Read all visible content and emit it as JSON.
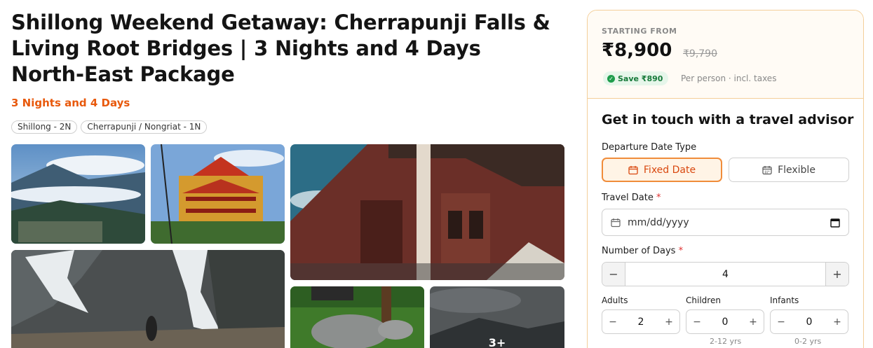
{
  "package": {
    "title": "Shillong Weekend Getaway: Cherrapunji Falls & Living Root Bridges | 3 Nights and 4 Days North-East Package",
    "duration": "3 Nights and 4 Days",
    "chips": [
      "Shillong - 2N",
      "Cherrapunji / Nongriat - 1N"
    ]
  },
  "gallery": {
    "more_label": "3+"
  },
  "pricing": {
    "starting_from": "STARTING FROM",
    "price": "₹8,900",
    "old_price": "₹9,790",
    "save_label": "Save ₹890",
    "per_person": "Per person · incl. taxes"
  },
  "form": {
    "title": "Get in touch with a travel advisor",
    "departure_label": "Departure Date Type",
    "fixed_label": "Fixed Date",
    "flexible_label": "Flexible",
    "travel_date_label": "Travel Date",
    "required_mark": "*",
    "date_placeholder": "mm/dd/yyyy",
    "days_label": "Number of Days",
    "days_value": "4",
    "minus": "−",
    "plus": "+",
    "adults_label": "Adults",
    "adults_value": "2",
    "children_label": "Children",
    "children_value": "0",
    "children_hint": "2-12 yrs",
    "infants_label": "Infants",
    "infants_value": "0",
    "infants_hint": "0-2 yrs"
  },
  "colors": {
    "accent": "#e8590c",
    "save_green": "#177a3a",
    "panel_border": "#f4cf9a"
  }
}
